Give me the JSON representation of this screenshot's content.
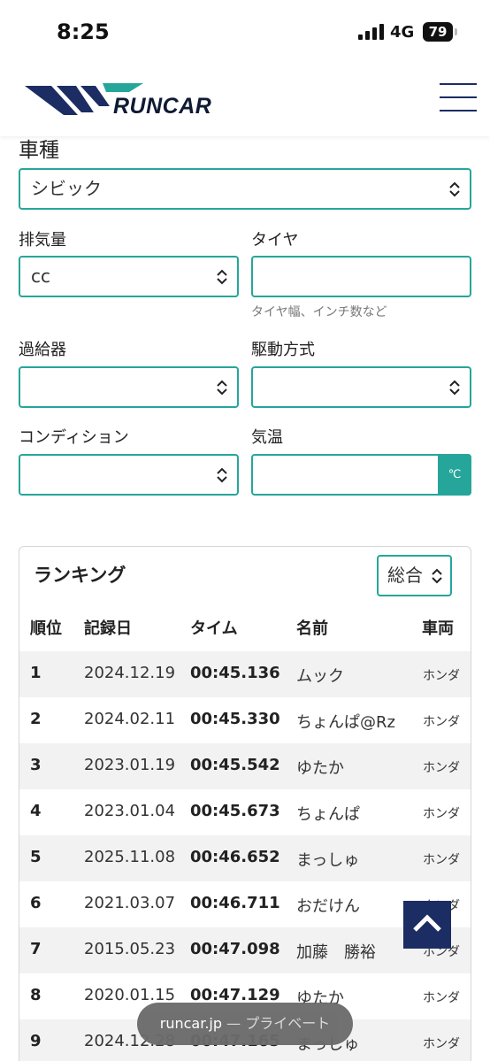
{
  "status": {
    "time": "8:25",
    "network": "4G",
    "battery": "79"
  },
  "header": {
    "logo_text": "RUNCAR",
    "colors": {
      "navy": "#1b2d63",
      "teal": "#26a69a"
    }
  },
  "form": {
    "car_model": {
      "label": "車種",
      "value": "シビック"
    },
    "displacement": {
      "label": "排気量",
      "value": "cc"
    },
    "tire": {
      "label": "タイヤ",
      "value": "",
      "hint": "タイヤ幅、インチ数など"
    },
    "supercharger": {
      "label": "過給器",
      "value": ""
    },
    "drive": {
      "label": "駆動方式",
      "value": ""
    },
    "condition": {
      "label": "コンディション",
      "value": ""
    },
    "temperature": {
      "label": "気温",
      "value": "",
      "unit": "℃"
    }
  },
  "ranking": {
    "title": "ランキング",
    "filter_value": "総合",
    "columns": [
      "順位",
      "記録日",
      "タイム",
      "名前",
      "車両"
    ],
    "rows": [
      {
        "rank": "1",
        "date": "2024.12.19",
        "time": "00:45.136",
        "name": "ムック",
        "car": "ホンダ"
      },
      {
        "rank": "2",
        "date": "2024.02.11",
        "time": "00:45.330",
        "name": "ちょんぱ@Rz",
        "car": "ホンダ"
      },
      {
        "rank": "3",
        "date": "2023.01.19",
        "time": "00:45.542",
        "name": "ゆたか",
        "car": "ホンダ"
      },
      {
        "rank": "4",
        "date": "2023.01.04",
        "time": "00:45.673",
        "name": "ちょんぱ",
        "car": "ホンダ"
      },
      {
        "rank": "5",
        "date": "2025.11.08",
        "time": "00:46.652",
        "name": "まっしゅ",
        "car": "ホンダ"
      },
      {
        "rank": "6",
        "date": "2021.03.07",
        "time": "00:46.711",
        "name": "おだけん",
        "car": "ホンダ"
      },
      {
        "rank": "7",
        "date": "2015.05.23",
        "time": "00:47.098",
        "name": "加藤　勝裕",
        "car": "ホンダ"
      },
      {
        "rank": "8",
        "date": "2020.01.15",
        "time": "00:47.129",
        "name": "ゆたか",
        "car": "ホンダ"
      },
      {
        "rank": "9",
        "date": "2024.12.28",
        "time": "00:47.165",
        "name": "まっしゅ",
        "car": "ホンダ"
      }
    ]
  },
  "browser": {
    "domain": "runcar.jp",
    "mode": "— プライベート"
  }
}
